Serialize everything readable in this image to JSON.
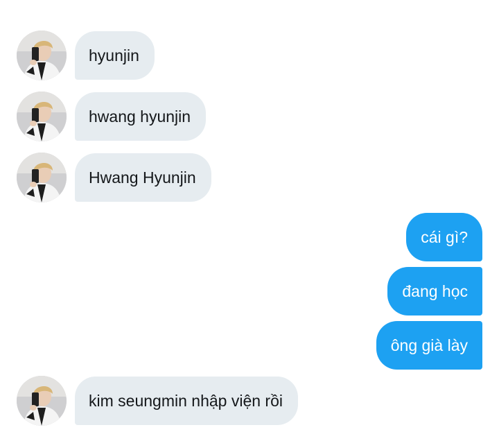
{
  "conversation": {
    "incoming_1": "hyunjin",
    "incoming_2": "hwang hyunjin",
    "incoming_3": "Hwang Hyunjin",
    "outgoing_1": "cái gì?",
    "outgoing_2": "đang học",
    "outgoing_3": "ông già lày",
    "incoming_4": "kim seungmin nhập viện rồi"
  },
  "colors": {
    "incoming_bubble": "#e6ecf0",
    "outgoing_bubble": "#1da1f2",
    "incoming_text": "#14171a",
    "outgoing_text": "#ffffff"
  },
  "icons": {
    "avatar": "user-avatar-photo"
  }
}
